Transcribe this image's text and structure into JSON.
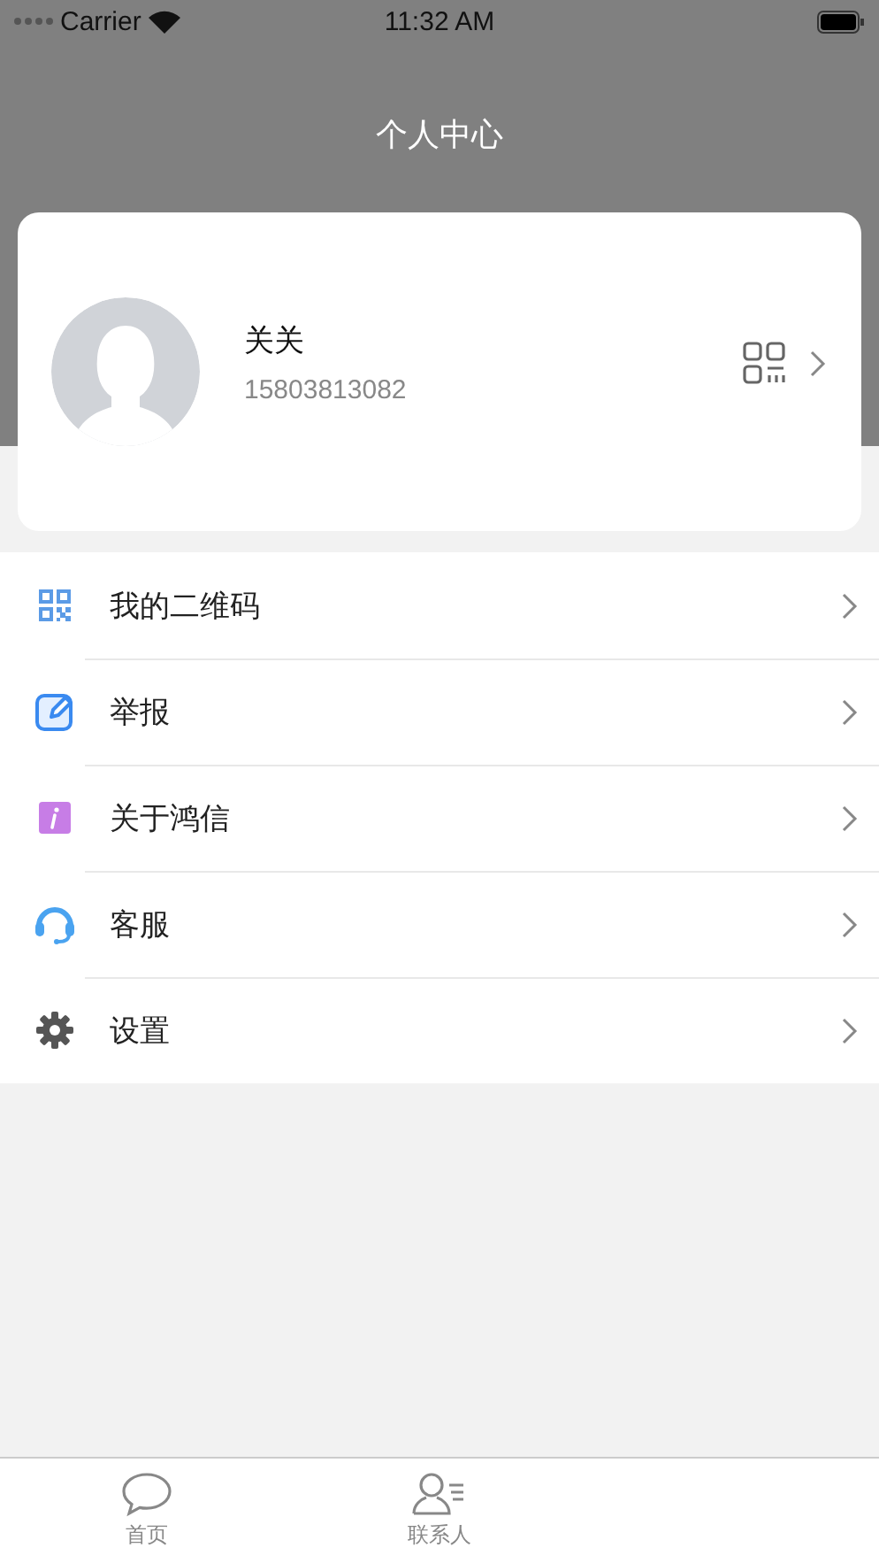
{
  "status_bar": {
    "carrier": "Carrier",
    "time": "11:32 AM"
  },
  "title": "个人中心",
  "profile": {
    "name": "关关",
    "phone": "15803813082"
  },
  "menu": [
    {
      "kind": "qrcode",
      "label": "我的二维码"
    },
    {
      "kind": "report",
      "label": "举报"
    },
    {
      "kind": "about",
      "label": "关于鸿信"
    },
    {
      "kind": "service",
      "label": "客服"
    },
    {
      "kind": "settings",
      "label": "设置"
    }
  ],
  "tab_bar": [
    {
      "kind": "chat",
      "label": "首页",
      "selected": false
    },
    {
      "kind": "contacts",
      "label": "联系人",
      "selected": false
    }
  ]
}
